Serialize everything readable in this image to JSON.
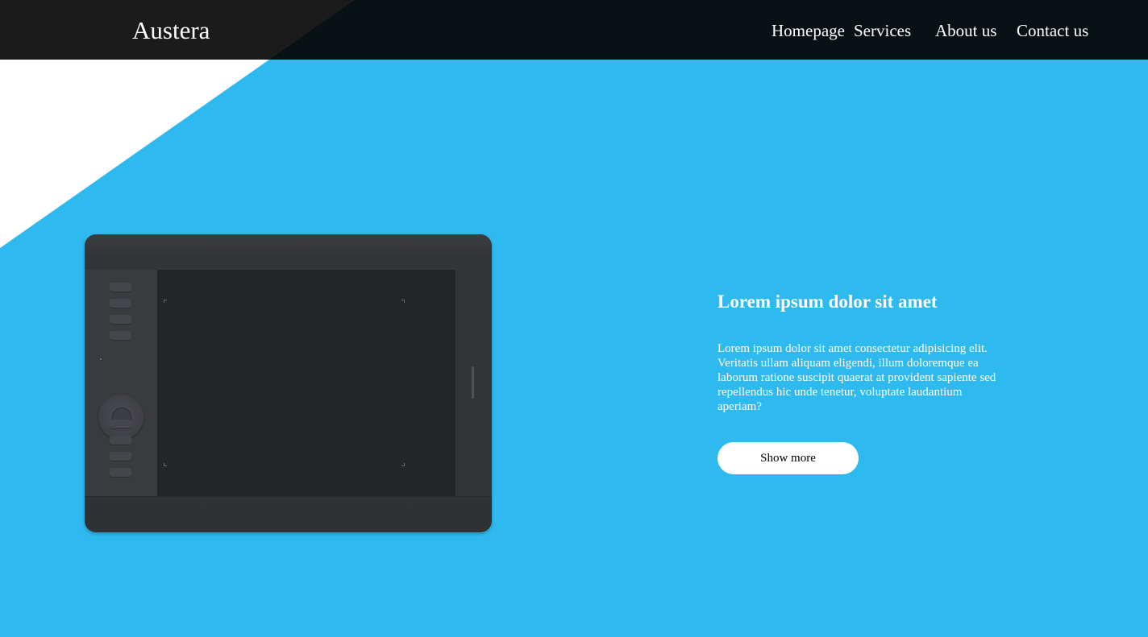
{
  "colors": {
    "background_accent": "#2fbaef",
    "header_bg": "#071116",
    "header_corner": "#1b1b1b",
    "wedge": "#ffffff",
    "button_bg": "#ffffff",
    "text_light": "#ffffff"
  },
  "header": {
    "logo": "Austera",
    "nav": [
      "Homepage",
      "Services",
      "About us",
      "Contact us"
    ]
  },
  "hero": {
    "image": "drawing-tablet-illustration",
    "title": "Lorem ipsum dolor sit amet",
    "body": "Lorem ipsum dolor sit amet consectetur adipisicing elit. Veritatis ullam aliquam eligendi, illum doloremque ea laborum ratione suscipit quaerat at provident sapiente sed repellendus hic unde tenetur, voluptate laudantium aperiam?",
    "button_label": "Show more"
  }
}
